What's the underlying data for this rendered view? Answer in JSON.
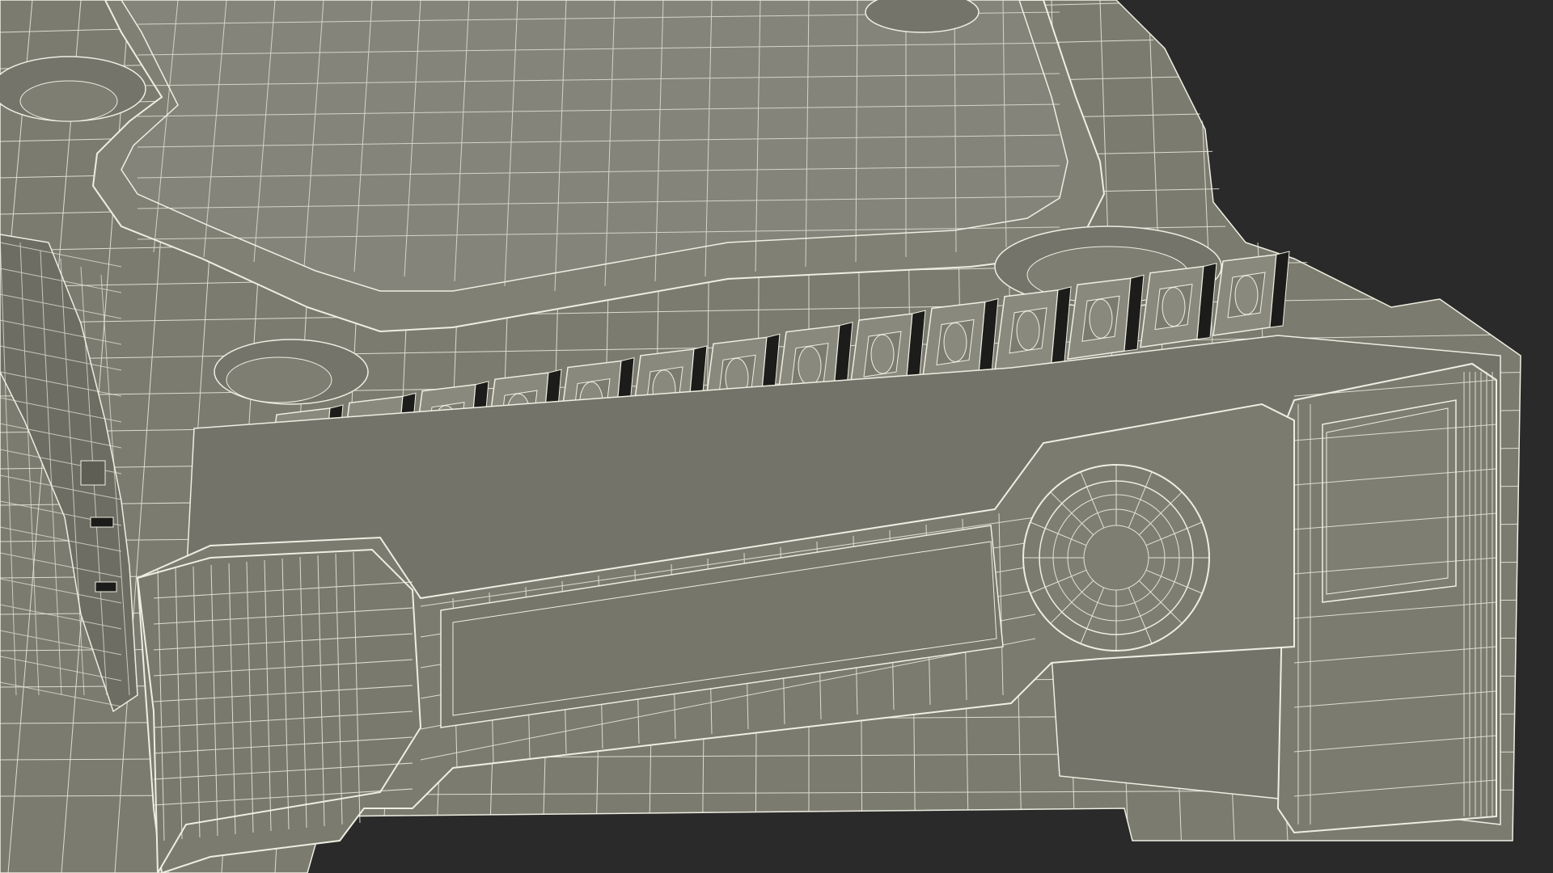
{
  "scene": {
    "subject": "",
    "render_style": "wireframe",
    "colors": {
      "background": "#2a2a2a",
      "surface": "#7c7b70",
      "surface_light": "#8a897d",
      "surface_dark": "#66655b",
      "slot": "#1c1c1a",
      "wire": "#eeeee2"
    },
    "slots": [
      {
        "label": ""
      },
      {
        "label": ""
      },
      {
        "label": ""
      },
      {
        "label": ""
      },
      {
        "label": ""
      },
      {
        "label": ""
      },
      {
        "label": ""
      },
      {
        "label": ""
      },
      {
        "label": ""
      },
      {
        "label": ""
      },
      {
        "label": ""
      },
      {
        "label": ""
      },
      {
        "label": ""
      },
      {
        "label": ""
      }
    ]
  }
}
